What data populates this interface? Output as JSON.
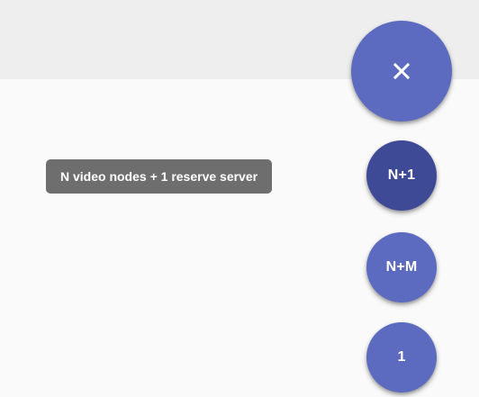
{
  "speed_dial": {
    "main_icon": "close-icon",
    "options": [
      {
        "label": "N+1",
        "tooltip": "N video nodes + 1 reserve server",
        "state": "hovered"
      },
      {
        "label": "N+M"
      },
      {
        "label": "1"
      }
    ]
  },
  "colors": {
    "fab": "#5c6bc0",
    "fab_hovered": "#3f4a96",
    "tooltip_bg": "#6e6e6e",
    "top_bar": "#eeeeee",
    "background": "#fafafa"
  }
}
